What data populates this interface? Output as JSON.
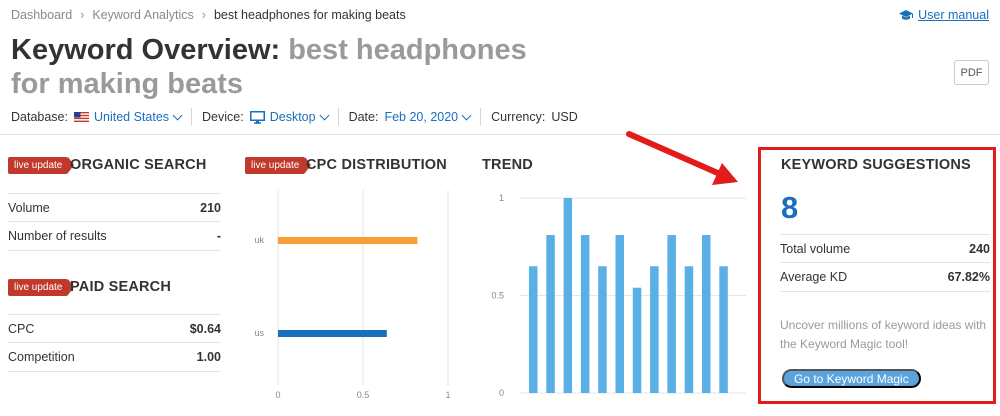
{
  "breadcrumb": {
    "items": [
      "Dashboard",
      "Keyword Analytics",
      "best headphones for making beats"
    ]
  },
  "user_manual": "User manual",
  "title": {
    "prefix": "Keyword Overview:",
    "keyword": "best headphones for making beats"
  },
  "pdf_label": "PDF",
  "filters": {
    "database_label": "Database:",
    "database_value": "United States",
    "device_label": "Device:",
    "device_value": "Desktop",
    "date_label": "Date:",
    "date_value": "Feb 20, 2020",
    "currency_label": "Currency:",
    "currency_value": "USD"
  },
  "badge_label": "live update",
  "organic": {
    "title": "ORGANIC SEARCH",
    "rows": [
      {
        "label": "Volume",
        "value": "210"
      },
      {
        "label": "Number of results",
        "value": "-"
      }
    ]
  },
  "paid": {
    "title": "PAID SEARCH",
    "rows": [
      {
        "label": "CPC",
        "value": "$0.64"
      },
      {
        "label": "Competition",
        "value": "1.00"
      }
    ]
  },
  "cpc": {
    "title": "CPC DISTRIBUTION",
    "chart_data": {
      "type": "bar",
      "orientation": "horizontal",
      "categories": [
        "uk",
        "us"
      ],
      "values": [
        0.82,
        0.64
      ],
      "colors": [
        "#f7a035",
        "#1a6fbd"
      ],
      "xlim": [
        0,
        1
      ],
      "xticks": [
        "0",
        "0.5",
        "1"
      ]
    }
  },
  "trend": {
    "title": "TREND",
    "chart_data": {
      "type": "bar",
      "values": [
        0.65,
        0.81,
        1.0,
        0.81,
        0.65,
        0.81,
        0.54,
        0.65,
        0.81,
        0.65,
        0.81,
        0.65
      ],
      "ylim": [
        0,
        1
      ],
      "yticks": [
        "0",
        "0.5",
        "1"
      ],
      "color": "#5aafe6",
      "grid": true
    }
  },
  "suggestions": {
    "title": "KEYWORD SUGGESTIONS",
    "count": "8",
    "rows": [
      {
        "label": "Total volume",
        "value": "240"
      },
      {
        "label": "Average KD",
        "value": "67.82%"
      }
    ],
    "description": "Uncover millions of keyword ideas with the Keyword Magic tool!",
    "button": "Go to Keyword Magic"
  },
  "colors": {
    "accent": "#1a6fbd",
    "badge": "#c0392b",
    "highlight": "#e21b1b"
  }
}
